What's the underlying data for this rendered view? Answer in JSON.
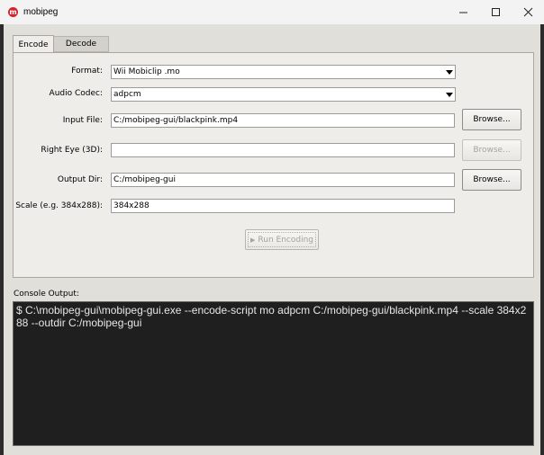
{
  "window": {
    "title": "mobipeg",
    "icon": "mobipeg-logo-icon",
    "icon_glyph": "m",
    "controls": [
      "minimize-icon",
      "maximize-icon",
      "close-icon"
    ]
  },
  "tabs": [
    {
      "label": "Encode",
      "active": true
    },
    {
      "label": "Decode",
      "active": false
    }
  ],
  "form": {
    "format": {
      "label": "Format:",
      "value": "Wii Mobiclip .mo"
    },
    "audio_codec": {
      "label": "Audio Codec:",
      "value": "adpcm"
    },
    "input_file": {
      "label": "Input File:",
      "value": "C:/mobipeg-gui/blackpink.mp4",
      "button": "Browse..."
    },
    "right_eye": {
      "label": "Right Eye (3D):",
      "value": "",
      "button": "Browse..."
    },
    "output_dir": {
      "label": "Output Dir:",
      "value": "C:/mobipeg-gui",
      "button": "Browse..."
    },
    "scale": {
      "label": "Scale (e.g. 384x288):",
      "value": "384x288"
    },
    "run_button": {
      "icon": "play-icon",
      "glyph": "▶",
      "label": "Run Encoding"
    }
  },
  "console": {
    "label": "Console Output:",
    "text": "$ C:\\mobipeg-gui\\mobipeg-gui.exe --encode-script mo adpcm C:/mobipeg-gui/blackpink.mp4 --scale 384x288 --outdir C:/mobipeg-gui"
  }
}
